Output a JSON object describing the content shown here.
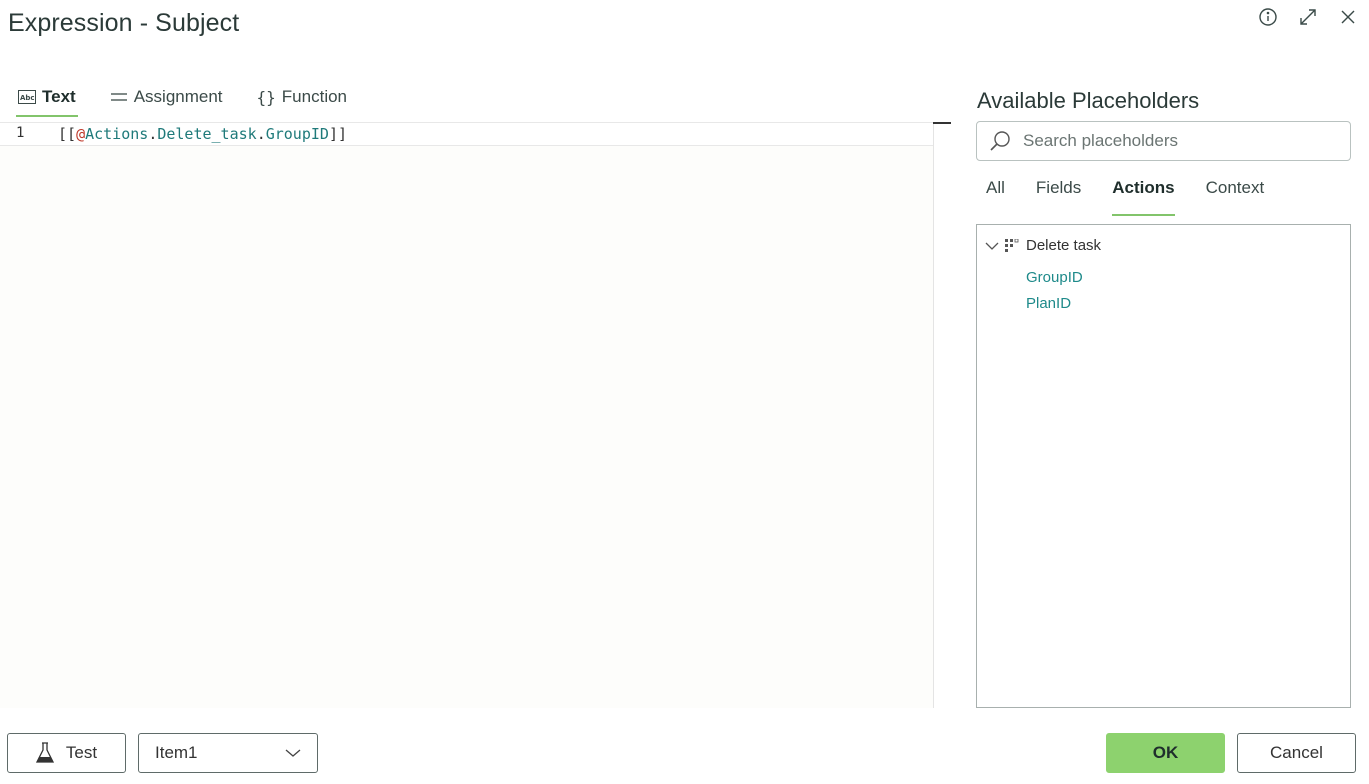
{
  "window": {
    "title": "Expression - Subject",
    "controls": [
      "info-icon",
      "expand-icon",
      "close-icon"
    ]
  },
  "editor_tabs": [
    {
      "label": "Text",
      "icon": "abc-icon",
      "active": true
    },
    {
      "label": "Assignment",
      "icon": "equals-icon",
      "active": false
    },
    {
      "label": "Function",
      "icon": "braces-icon",
      "active": false
    }
  ],
  "editor": {
    "line_number": "1",
    "code": {
      "open": "[[",
      "at": "@",
      "p1": "Actions",
      "d1": ".",
      "p2": "Delete_task",
      "d2": ".",
      "p3": "GroupID",
      "close": "]]"
    }
  },
  "placeholders": {
    "title": "Available Placeholders",
    "search_placeholder": "Search placeholders",
    "tabs": [
      {
        "label": "All",
        "active": false
      },
      {
        "label": "Fields",
        "active": false
      },
      {
        "label": "Actions",
        "active": true
      },
      {
        "label": "Context",
        "active": false
      }
    ],
    "tree": {
      "node_label": "Delete task",
      "expanded": true,
      "children": [
        "GroupID",
        "PlanID"
      ]
    }
  },
  "footer": {
    "test_label": "Test",
    "item_select_value": "Item1",
    "ok_label": "OK",
    "cancel_label": "Cancel"
  },
  "colors": {
    "accent_green": "#8dd26e",
    "tab_underline": "#82c46b",
    "link_teal": "#1e8a8a",
    "at_sign_red": "#c0392b"
  }
}
